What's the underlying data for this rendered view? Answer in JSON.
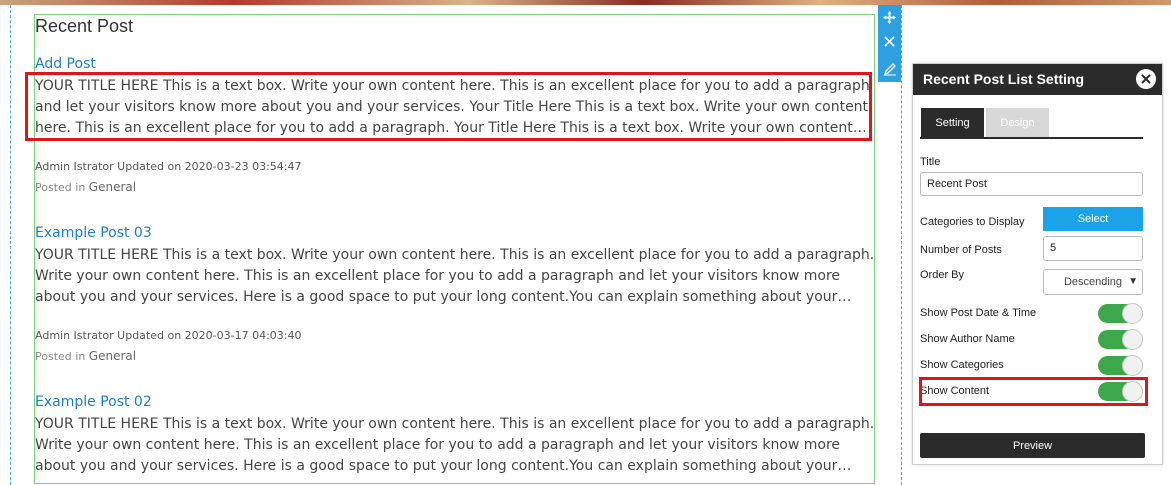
{
  "widget": {
    "title": "Recent Post",
    "posts": [
      {
        "title": "Add Post",
        "content": "YOUR TITLE HERE This is a text box. Write your own content here. This is an excellent place for you to add a paragraph and let your visitors know more about you and your services. Your Title Here This is a text box. Write your own content here. This is an excellent place for you to add a paragraph. Your Title Here This is a text box. Write your own content here. This is an excellent place for you to add a paragraph.",
        "meta": "Admin Istrator Updated on 2020-03-23 03:54:47",
        "posted_in": "Posted in",
        "category": "General"
      },
      {
        "title": "Example Post 03",
        "content": "YOUR TITLE HERE This is a text box. Write your own content here. This is an excellent place for you to add a paragraph. Write your own content here. This is an excellent place for you to add a paragraph and let your visitors know more about you and your services. Here is a good space to put your long content.You can explain something about your company and products. Feel free to write more.",
        "meta": "Admin Istrator Updated on 2020-03-17 04:03:40",
        "posted_in": "Posted in",
        "category": "General"
      },
      {
        "title": "Example Post 02",
        "content": "YOUR TITLE HERE This is a text box. Write your own content here. This is an excellent place for you to add a paragraph. Write your own content here. This is an excellent place for you to add a paragraph and let your visitors know more about you and your services. Here is a good space to put your long content.You can explain something about your company and products. Feel free to write more."
      }
    ]
  },
  "tools": {
    "move_icon": "move-arrows-icon",
    "close_icon": "close-icon",
    "edit_icon": "pencil-icon"
  },
  "panel": {
    "title": "Recent Post List Setting",
    "tabs": [
      "Setting",
      "Design"
    ],
    "title_label": "Title",
    "title_value": "Recent Post",
    "categories_label": "Categories to Display",
    "select_label": "Select",
    "num_posts_label": "Number of Posts",
    "num_posts_value": "5",
    "order_by_label": "Order By",
    "order_by_value": "Descending",
    "toggles": [
      {
        "label": "Show Post Date & Time",
        "on": true
      },
      {
        "label": "Show Author Name",
        "on": true
      },
      {
        "label": "Show Categories",
        "on": true
      },
      {
        "label": "Show Content",
        "on": true
      }
    ],
    "preview_label": "Preview"
  },
  "colors": {
    "link": "#1e7bc8",
    "highlight": "#e0151b",
    "toggle_on": "#3da84b",
    "select_button": "#1aa3e8",
    "tool_strip": "#2ea0e0",
    "panel_dark": "#2b2b2b"
  }
}
